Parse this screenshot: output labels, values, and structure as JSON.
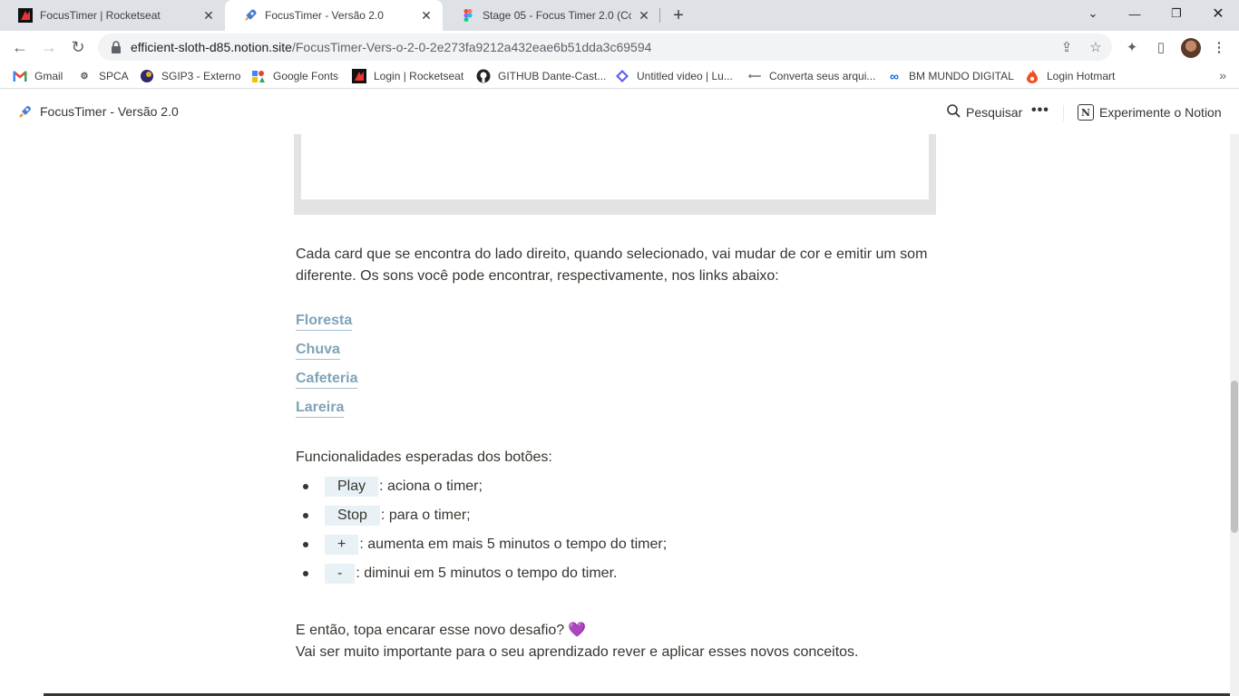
{
  "browser": {
    "tabs": [
      {
        "title": "FocusTimer | Rocketseat",
        "icon": "rocketseat-icon"
      },
      {
        "title": "FocusTimer - Versão 2.0",
        "icon": "rocket-icon"
      },
      {
        "title": "Stage 05 - Focus Timer 2.0 (Copy",
        "icon": "figma-icon"
      }
    ],
    "url_host": "efficient-sloth-d85.notion.site",
    "url_path": "/FocusTimer-Vers-o-2-0-2e273fa9212a432eae6b51dda3c69594",
    "bookmarks": [
      {
        "label": "Gmail",
        "icon": "gmail-icon"
      },
      {
        "label": "SPCA",
        "icon": "spca-icon"
      },
      {
        "label": "SGIP3 - Externo",
        "icon": "sgip-icon"
      },
      {
        "label": "Google Fonts",
        "icon": "google-fonts-icon"
      },
      {
        "label": "Login | Rocketseat",
        "icon": "rocketseat-icon"
      },
      {
        "label": "GITHUB Dante-Cast...",
        "icon": "github-icon"
      },
      {
        "label": "Untitled video | Lu...",
        "icon": "loom-icon"
      },
      {
        "label": "Converta seus arqui...",
        "icon": "convert-icon"
      },
      {
        "label": "BM MUNDO DIGITAL",
        "icon": "meta-icon"
      },
      {
        "label": "Login Hotmart",
        "icon": "hotmart-icon"
      }
    ],
    "more_bookmarks": "»"
  },
  "notion_header": {
    "page_title": "FocusTimer - Versão 2.0",
    "search_label": "Pesquisar",
    "more_label": "•••",
    "try_label": "Experimente o Notion"
  },
  "content": {
    "intro_line1": "Cada card que se encontra do lado direito, quando selecionado, vai mudar de cor e emitir um som",
    "intro_line2": "diferente. Os sons você pode encontrar, respectivamente, nos links abaixo:",
    "links": [
      "Floresta",
      "Chuva",
      "Cafeteria",
      "Lareira"
    ],
    "functions_heading": "Funcionalidades esperadas dos botões:",
    "bullets": [
      {
        "code": "Play",
        "text": ": aciona o timer;"
      },
      {
        "code": "Stop",
        "text": ": para o timer;"
      },
      {
        "code": "+",
        "text": ": aumenta em mais 5 minutos o tempo do timer;"
      },
      {
        "code": "-",
        "text": ": diminui em 5 minutos o tempo do timer."
      }
    ],
    "challenge_line": "E então, topa encarar esse novo desafio?",
    "challenge_emoji": "💜",
    "important_line": "Vai ser muito importante para o seu aprendizado rever e aplicar esses novos conceitos."
  },
  "colors": {
    "link": "#7ea3b8",
    "code_bg": "#e8f1f6",
    "text": "#37352f",
    "heart": "#9b7ad1"
  }
}
